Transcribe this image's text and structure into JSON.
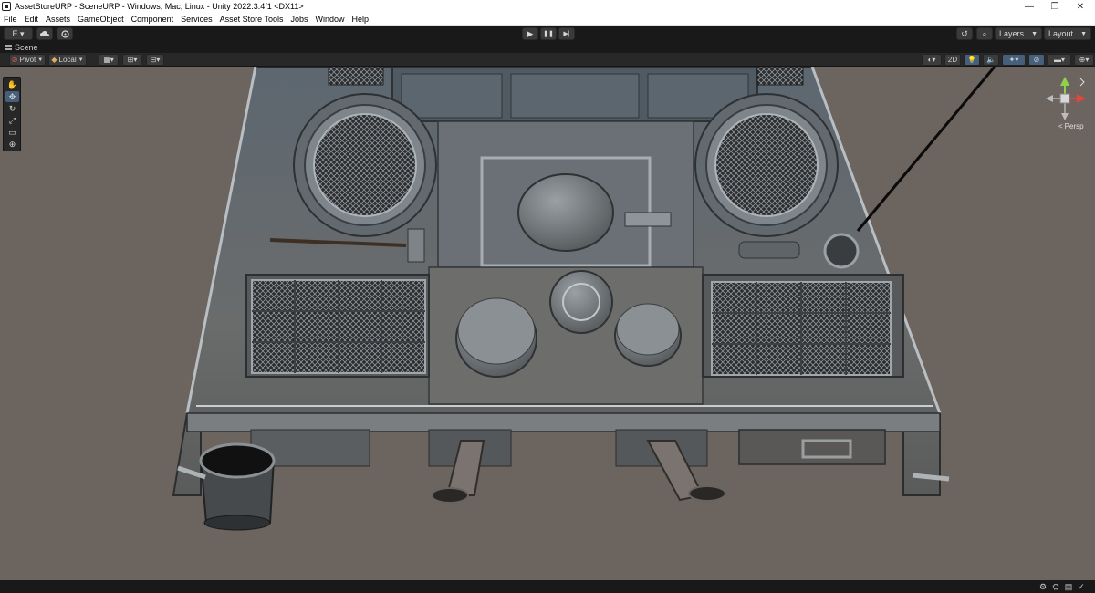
{
  "window": {
    "title": "AssetStoreURP - SceneURP - Windows, Mac, Linux - Unity 2022.3.4f1 <DX11>",
    "controls": {
      "minimize": "—",
      "maximize": "❐",
      "close": "✕"
    }
  },
  "menu": {
    "items": [
      "File",
      "Edit",
      "Assets",
      "GameObject",
      "Component",
      "Services",
      "Asset Store Tools",
      "Jobs",
      "Window",
      "Help"
    ]
  },
  "toolbar": {
    "account_label": "E ▾",
    "cloud_icon": "cloud-icon",
    "collab_icon": "collab-icon",
    "play_glyph": "▶",
    "pause_glyph": "❚❚",
    "step_glyph": "▶|",
    "history_glyph": "↺",
    "search_glyph": "⌕",
    "layers_label": "Layers",
    "layout_label": "Layout"
  },
  "tabs": {
    "scene_label": "Scene"
  },
  "scene_toolbar": {
    "pivot_label": "Pivot",
    "local_label": "Local",
    "mode_2d_label": "2D",
    "persp_label": "Persp"
  },
  "tools": {
    "hand": "✋",
    "move": "✥",
    "rotate": "↻",
    "scale": "⤢",
    "rect": "▭",
    "transform": "⊕"
  },
  "colors": {
    "viewport_bg": "#6b645f",
    "editor_dark": "#191919",
    "toolbar_gray": "#282828",
    "active_blue": "#46607c",
    "gizmo_y": "#8fd14f",
    "gizmo_x": "#e0463c"
  }
}
